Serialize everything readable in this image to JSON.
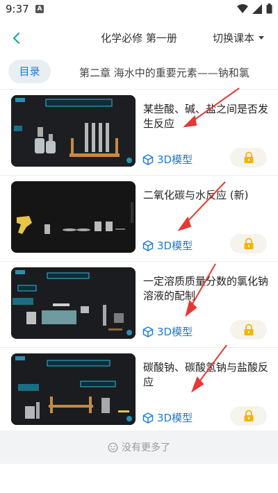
{
  "status": {
    "time": "9:37",
    "notif_letter": "A"
  },
  "header": {
    "title": "化学必修 第一册",
    "switch_label": "切换课本"
  },
  "chapter": {
    "toc_label": "目录",
    "title": "第二章 海水中的重要元素——钠和氯"
  },
  "items": [
    {
      "title": "某些酸、碱、盐之间是否发生反应",
      "model_label": "3D模型",
      "locked": true
    },
    {
      "title": "二氧化碳与水反应 (新)",
      "model_label": "3D模型",
      "locked": true
    },
    {
      "title": "一定溶质质量分数的氯化钠溶液的配制",
      "model_label": "3D模型",
      "locked": true
    },
    {
      "title": "碳酸钠、碳酸氢钠与盐酸反应",
      "model_label": "3D模型",
      "locked": true
    }
  ],
  "footer": {
    "no_more_text": "没有更多了"
  },
  "colors": {
    "accent_blue": "#1a7bd6",
    "lock_yellow": "#f5b400",
    "annotation_red": "#e53935"
  }
}
